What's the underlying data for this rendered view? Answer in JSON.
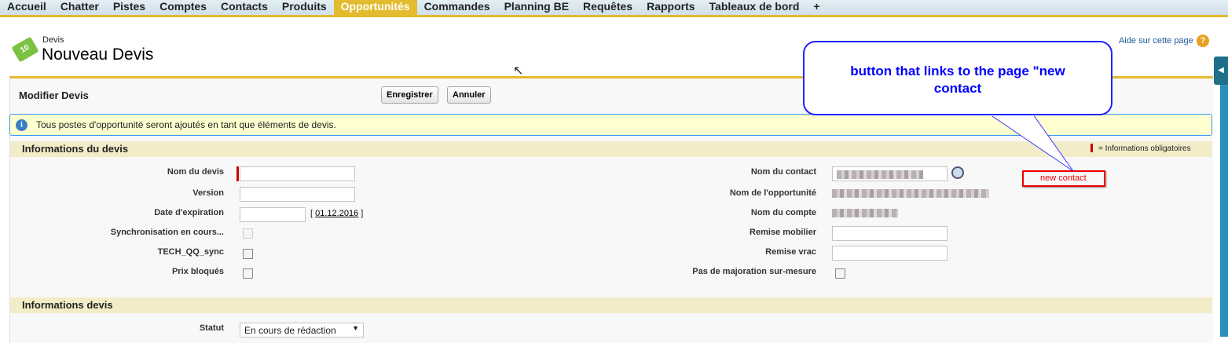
{
  "nav": {
    "tabs": [
      "Accueil",
      "Chatter",
      "Pistes",
      "Comptes",
      "Contacts",
      "Produits",
      "Opportunités",
      "Commandes",
      "Planning BE",
      "Requêtes",
      "Rapports",
      "Tableaux de bord",
      "+"
    ],
    "active": "Opportunités"
  },
  "header": {
    "object": "Devis",
    "title": "Nouveau Devis",
    "help": "Aide sur cette page"
  },
  "panel": {
    "title": "Modifier Devis",
    "save": "Enregistrer",
    "cancel": "Annuler"
  },
  "info": "Tous postes d'opportunité seront ajoutés en tant que éléments de devis.",
  "section1": {
    "title": "Informations du devis",
    "required_legend": "= Informations obligatoires",
    "left": {
      "name": "Nom du devis",
      "version": "Version",
      "expiration": "Date d'expiration",
      "expiration_default": "01.12.2016",
      "sync": "Synchronisation en cours...",
      "tech": "TECH_QQ_sync",
      "locked": "Prix bloqués"
    },
    "right": {
      "contact": "Nom du contact",
      "opportunity": "Nom de l'opportunité",
      "account": "Nom du compte",
      "remise_mobilier": "Remise mobilier",
      "remise_vrac": "Remise vrac",
      "majoration": "Pas de majoration sur-mesure"
    },
    "new_contact": "new contact"
  },
  "section2": {
    "title": "Informations devis",
    "status_label": "Statut",
    "status_value": "En cours de rédaction"
  },
  "callout": "button that links to the page \"new contact"
}
